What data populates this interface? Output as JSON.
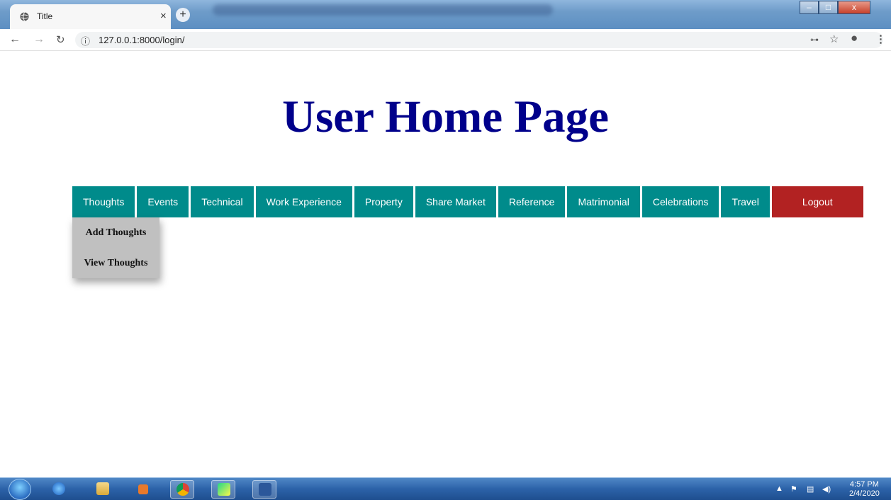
{
  "browser": {
    "tab_title": "Title",
    "tab_close": "×",
    "new_tab": "+",
    "url": "127.0.0.1:8000/login/",
    "info_icon": "ⓘ",
    "window_controls": {
      "minimize": "–",
      "maximize": "□",
      "close": "x"
    }
  },
  "page": {
    "heading": "User Home Page",
    "menu": [
      {
        "label": "Thoughts"
      },
      {
        "label": "Events"
      },
      {
        "label": "Technical"
      },
      {
        "label": "Work Experience"
      },
      {
        "label": "Property"
      },
      {
        "label": "Share Market"
      },
      {
        "label": "Reference"
      },
      {
        "label": "Matrimonial"
      },
      {
        "label": "Celebrations"
      },
      {
        "label": "Travel"
      }
    ],
    "logout_label": "Logout",
    "dropdown": {
      "items": [
        {
          "label": "Add Thoughts"
        },
        {
          "label": "View Thoughts"
        }
      ]
    }
  },
  "taskbar": {
    "time": "4:57 PM",
    "date": "2/4/2020"
  },
  "colors": {
    "menu_bg": "#008b8b",
    "logout_bg": "#b22222",
    "heading": "#00008b",
    "dropdown_bg": "#c0c0c0"
  }
}
